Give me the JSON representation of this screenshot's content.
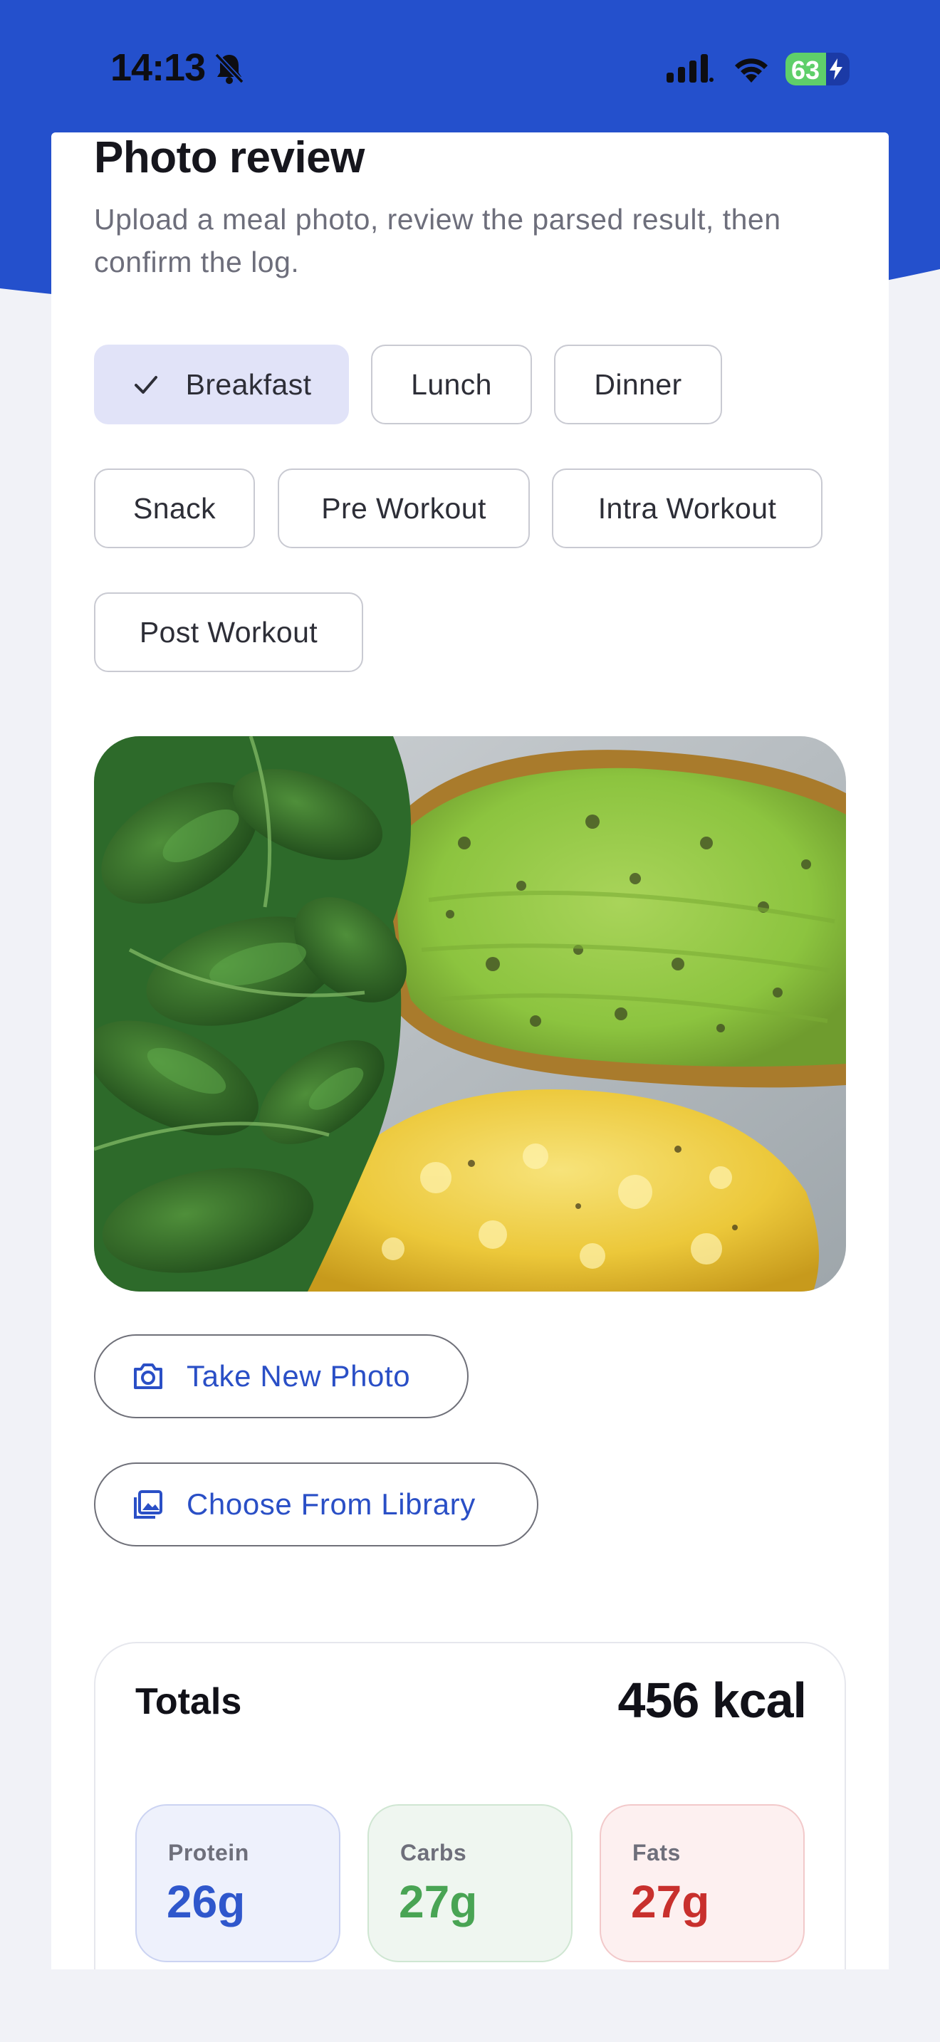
{
  "colors": {
    "header_blue": "#2450cc",
    "accent_blue": "#2a4fc6",
    "selected_chip_bg": "#e1e3f8",
    "protein": "#2f57cc",
    "carbs": "#49a454",
    "fats": "#c8302d"
  },
  "status_bar": {
    "time": "14:13",
    "battery_percent": "63",
    "battery_level": 0.63,
    "icons": [
      "bell-slash-icon",
      "cellular-signal-icon",
      "wifi-icon",
      "battery-charging-icon"
    ]
  },
  "header": {
    "title": "Photo review",
    "subtitle": "Upload a meal photo, review the parsed result, then confirm the log."
  },
  "meal_types": [
    {
      "label": "Breakfast",
      "selected": true
    },
    {
      "label": "Lunch",
      "selected": false
    },
    {
      "label": "Dinner",
      "selected": false
    },
    {
      "label": "Snack",
      "selected": false
    },
    {
      "label": "Pre Workout",
      "selected": false
    },
    {
      "label": "Intra Workout",
      "selected": false
    },
    {
      "label": "Post Workout",
      "selected": false
    }
  ],
  "actions": {
    "take_photo": {
      "label": "Take New Photo",
      "icon": "camera-icon"
    },
    "choose_library": {
      "label": "Choose From Library",
      "icon": "photo-library-icon"
    }
  },
  "totals": {
    "title": "Totals",
    "kcal": "456 kcal",
    "macros": [
      {
        "label": "Protein",
        "value": "26g"
      },
      {
        "label": "Carbs",
        "value": "27g"
      },
      {
        "label": "Fats",
        "value": "27g"
      }
    ]
  }
}
